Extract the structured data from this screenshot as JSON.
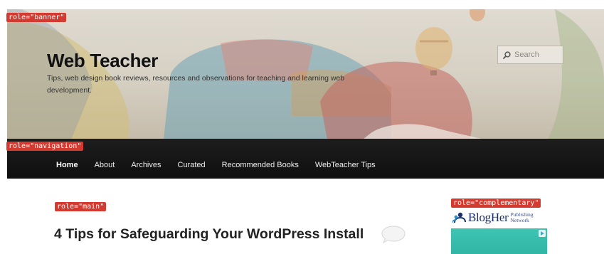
{
  "annotations": {
    "banner": "role=\"banner\"",
    "navigation": "role=\"navigation\"",
    "main": "role=\"main\"",
    "complementary": "role=\"complementary\""
  },
  "site": {
    "title": "Web Teacher",
    "description": "Tips, web design book reviews, resources and observations for teaching and learning web development."
  },
  "search": {
    "placeholder": "Search",
    "icon": "magnifier-icon"
  },
  "nav": {
    "items": [
      "Home",
      "About",
      "Archives",
      "Curated",
      "Recommended Books",
      "WebTeacher Tips"
    ],
    "active_index": 0
  },
  "main": {
    "post_title": "4 Tips for Safeguarding Your WordPress Install",
    "comment_icon": "speech-bubble-icon"
  },
  "sidebar": {
    "brand_name": "BlogHer",
    "brand_sub_1": "Publishing",
    "brand_sub_2": "Network",
    "ad_color": "#38bcac"
  },
  "colors": {
    "annotation_tag": "#d43a2f",
    "nav_background": "#111111"
  }
}
